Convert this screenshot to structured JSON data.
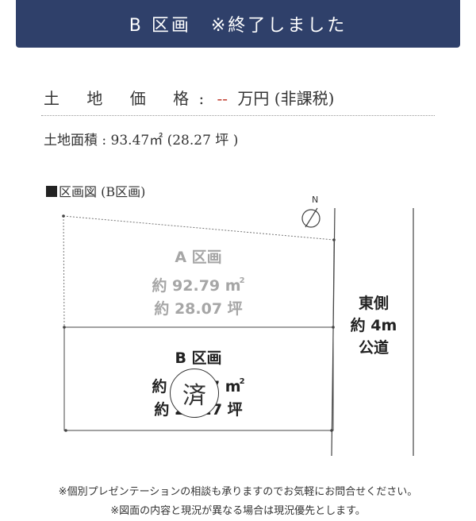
{
  "banner": {
    "title": "B 区画　※終了しました"
  },
  "price": {
    "label": "土 地 価 格",
    "colon": ":",
    "value": "--",
    "unit": "万円",
    "tax_note": "(非課税)"
  },
  "area": {
    "text": "土地面積 : 93.47㎡ (28.27 坪 )"
  },
  "site_map": {
    "title": "区画図 (B区画)",
    "north": "N",
    "lot_a": {
      "name": "A 区画",
      "area_sqm": "約 92.79",
      "sqm_unit": "m",
      "sqm_sup": "2",
      "area_tsubo": "約 28.07 坪"
    },
    "lot_b": {
      "name": "B 区画",
      "area_sqm": "約 93.47",
      "sqm_unit": "m",
      "sqm_sup": "2",
      "area_tsubo": "約 28.27 坪"
    },
    "sold_stamp": "済",
    "road": {
      "line1": "東側",
      "line2": "約 4m",
      "line3": "公道"
    }
  },
  "notes": {
    "line1": "※個別プレゼンテーションの相談も承りますのでお気軽にお問合せください。",
    "line2": "※図面の内容と現況が異なる場合は現況優先とします。"
  },
  "colors": {
    "banner_bg": "#2f406a",
    "price_value": "#c0392b",
    "lot_a_text": "#a6a6a6"
  }
}
